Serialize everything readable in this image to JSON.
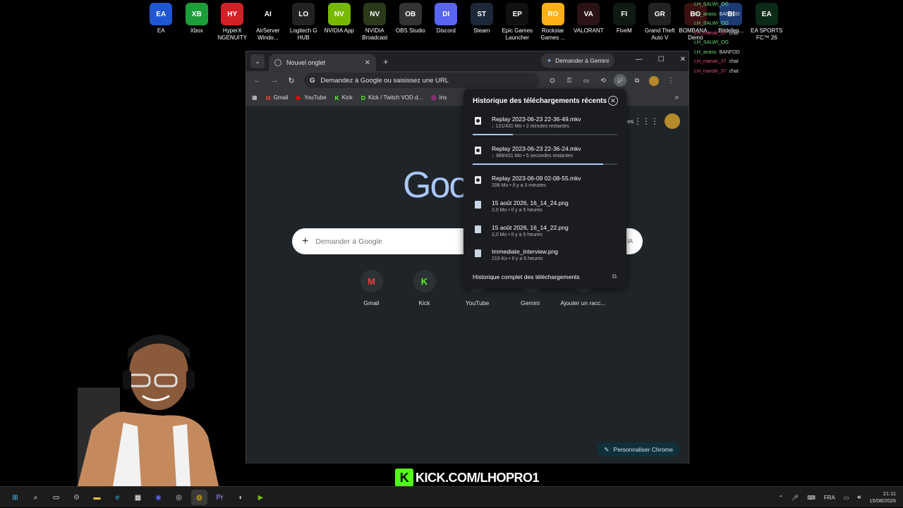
{
  "desktop": {
    "icons": [
      {
        "label": "EA",
        "icon": "ea-icon",
        "color": "#1e56d4"
      },
      {
        "label": "Xbox",
        "icon": "xbox-icon",
        "color": "#1c9e3b"
      },
      {
        "label": "HyperX NGENUITY",
        "icon": "hyperx-icon",
        "color": "#d32027"
      },
      {
        "label": "AirServer Windo...",
        "icon": "airserver-icon",
        "color": "#000000"
      },
      {
        "label": "Logitech G HUB",
        "icon": "logitech-icon",
        "color": "#222222"
      },
      {
        "label": "NVIDIA App",
        "icon": "nvidia-icon",
        "color": "#76b900"
      },
      {
        "label": "NVIDIA Broadcast",
        "icon": "nvidia-broadcast-icon",
        "color": "#2b3a1a"
      },
      {
        "label": "OBS Studio",
        "icon": "obs-icon",
        "color": "#333333"
      },
      {
        "label": "Discord",
        "icon": "discord-icon",
        "color": "#5865f2"
      },
      {
        "label": "Steam",
        "icon": "steam-icon",
        "color": "#1b2838"
      },
      {
        "label": "Epic Games Launcher",
        "icon": "epic-icon",
        "color": "#111111"
      },
      {
        "label": "Rockstar Games ...",
        "icon": "rockstar-icon",
        "color": "#fcaf17"
      },
      {
        "label": "VALORANT",
        "icon": "valorant-icon",
        "color": "#2a1215"
      },
      {
        "label": "FiveM",
        "icon": "fivem-icon",
        "color": "#0e1a12"
      },
      {
        "label": "Grand Theft Auto V",
        "icon": "gta-icon",
        "color": "#222222"
      },
      {
        "label": "BOMBANA... Demo",
        "icon": "bombana-icon",
        "color": "#3a1010"
      },
      {
        "label": "Bitdefen...",
        "icon": "bitdefender-icon",
        "color": "#1d3b73"
      },
      {
        "label": "EA SPORTS FC™ 26",
        "icon": "eafc-icon",
        "color": "#0b2a17"
      }
    ],
    "chat": [
      {
        "user": "LH_SALWI_OG",
        "msg": "",
        "cls": "u1"
      },
      {
        "user": "LH_anass",
        "msg": "BANFOD",
        "cls": "u1"
      },
      {
        "user": "LH_SALWI_OG",
        "msg": "",
        "cls": "u1"
      },
      {
        "user": "LH_maroki_37",
        "msg": "chat",
        "cls": "u2"
      },
      {
        "user": "LH_SALWI_OG",
        "msg": "",
        "cls": "u1"
      },
      {
        "user": "LH_anass",
        "msg": "BANFOD",
        "cls": "u1"
      },
      {
        "user": "LH_maroki_37",
        "msg": "chat",
        "cls": "u2"
      },
      {
        "user": "LH_maroki_37",
        "msg": "chat",
        "cls": "u2"
      }
    ]
  },
  "browser": {
    "tab_title": "Nouvel onglet",
    "gemini_button": "Demander à Gemini",
    "omnibox_text": "Demandez à Google ou saisissez une URL",
    "download_badge": "2",
    "bookmarks": [
      {
        "label": "Gmail",
        "icon": "M",
        "color": "#ea4335"
      },
      {
        "label": "YouTube",
        "icon": "▶",
        "color": "#ff0000"
      },
      {
        "label": "Kick",
        "icon": "K",
        "color": "#53fc18"
      },
      {
        "label": "Kick / Twitch VOD d...",
        "icon": "D",
        "color": "#53fc18"
      },
      {
        "label": "Ins",
        "icon": "◎",
        "color": "#d6249f"
      }
    ]
  },
  "ntp": {
    "logo": "Goo",
    "search_placeholder": "Demander à Google",
    "ia_label": "IA",
    "shortcuts": [
      {
        "label": "Gmail",
        "icon": "M",
        "color": "#ea4335"
      },
      {
        "label": "Kick",
        "icon": "K",
        "color": "#53fc18"
      },
      {
        "label": "YouTube",
        "icon": "▶",
        "color": "#ff0000"
      },
      {
        "label": "Gemini",
        "icon": "✦",
        "color": "#8ab4f8"
      },
      {
        "label": "Ajouter un racc...",
        "icon": "+",
        "color": "#ccc"
      }
    ],
    "customize_label": "Personnaliser Chrome",
    "partial_label": "es"
  },
  "downloads": {
    "title": "Historique des téléchargements récents",
    "items": [
      {
        "name": "Replay 2023-06-23 22-36-49.mkv",
        "status": "↓ 121/431 Mo • 2 minutes restantes",
        "type": "vid",
        "progress": 0.28
      },
      {
        "name": "Replay 2023-06-23 22-36-24.mkv",
        "status": "↓ 389/431 Mo • 5 secondes restantes",
        "type": "vid",
        "progress": 0.9
      },
      {
        "name": "Replay 2023-06-09 02-08-55.mkv",
        "status": "208 Mo • Il y a 3 minutes",
        "type": "vid",
        "progress": null
      },
      {
        "name": "15 août 2026, 16_14_24.png",
        "status": "2,0 Mo • Il y a 5 heures",
        "type": "img",
        "progress": null
      },
      {
        "name": "15 août 2026, 16_14_22.png",
        "status": "2,0 Mo • Il y a 5 heures",
        "type": "img",
        "progress": null
      },
      {
        "name": "Immediate_interview.png",
        "status": "219 Ko • Il y a 5 heures",
        "type": "img",
        "progress": null
      }
    ],
    "footer": "Historique complet des téléchargements"
  },
  "overlay": {
    "kick_url": "KICK.COM/LHOPRO1"
  },
  "taskbar": {
    "apps": [
      {
        "icon": "windows-start-icon",
        "glyph": "⊞",
        "color": "#4cc2ff"
      },
      {
        "icon": "search-icon",
        "glyph": "⌕",
        "color": "#fff"
      },
      {
        "icon": "task-view-icon",
        "glyph": "▭",
        "color": "#fff"
      },
      {
        "icon": "settings-icon",
        "glyph": "⚙",
        "color": "#aaa"
      },
      {
        "icon": "file-explorer-icon",
        "glyph": "▬",
        "color": "#f5c243"
      },
      {
        "icon": "edge-icon",
        "glyph": "e",
        "color": "#2fb4e9"
      },
      {
        "icon": "store-icon",
        "glyph": "▦",
        "color": "#fff"
      },
      {
        "icon": "discord-icon",
        "glyph": "◉",
        "color": "#5865f2"
      },
      {
        "icon": "obs-icon",
        "glyph": "◎",
        "color": "#ddd"
      },
      {
        "icon": "chrome-icon",
        "glyph": "◍",
        "color": "#fbbc04"
      },
      {
        "icon": "premiere-icon",
        "glyph": "Pr",
        "color": "#9999ff"
      },
      {
        "icon": "mouse-icon",
        "glyph": "◖",
        "color": "#ddd"
      },
      {
        "icon": "nvidia-broadcast-icon",
        "glyph": "▶",
        "color": "#76b900"
      }
    ],
    "language": "FRA",
    "time": "21:11",
    "date": "15/08/2026"
  }
}
